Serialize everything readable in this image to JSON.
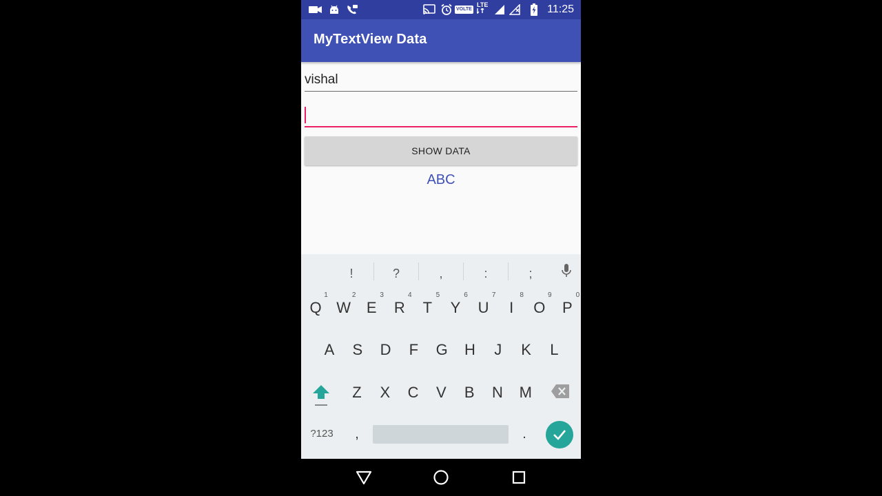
{
  "status_bar": {
    "time": "11:25",
    "network": "LTE",
    "volte": "VOLTE"
  },
  "app": {
    "title": "MyTextView Data"
  },
  "form": {
    "name_value": "vishal",
    "second_value": "",
    "button_label": "SHOW DATA",
    "result_text": "ABC"
  },
  "keyboard": {
    "suggestions": [
      "!",
      "?",
      ",",
      ":",
      ";"
    ],
    "row1": [
      "Q",
      "W",
      "E",
      "R",
      "T",
      "Y",
      "U",
      "I",
      "O",
      "P"
    ],
    "row1_numbers": [
      "1",
      "2",
      "3",
      "4",
      "5",
      "6",
      "7",
      "8",
      "9",
      "0"
    ],
    "row2": [
      "A",
      "S",
      "D",
      "F",
      "G",
      "H",
      "J",
      "K",
      "L"
    ],
    "row3": [
      "Z",
      "X",
      "C",
      "V",
      "B",
      "N",
      "M"
    ],
    "symbols_label": "?123",
    "comma": ",",
    "period": ".",
    "accent_color": "#26a69a"
  }
}
